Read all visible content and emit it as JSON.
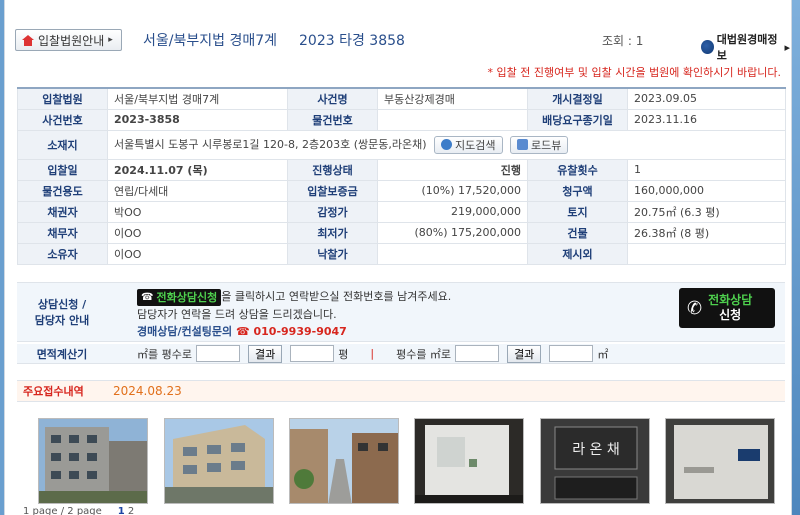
{
  "header": {
    "court_button": "입찰법원안내",
    "title": "서울/북부지법 경매7계",
    "case_no": "2023 타경 3858",
    "views_label": "조회 : 1",
    "supreme_link": "대법원경매정보"
  },
  "notice": "* 입찰 전 진행여부 및 입찰 시간을 법원에 확인하시기 바랍니다.",
  "info": {
    "court_label": "입찰법원",
    "court": "서울/북부지법 경매7계",
    "case_name_label": "사건명",
    "case_name": "부동산강제경매",
    "start_label": "개시결정일",
    "start": "2023.09.05",
    "case_no_label": "사건번호",
    "case_no": "2023-3858",
    "item_no_label": "물건번호",
    "item_no": "",
    "deadline_label": "배당요구종기일",
    "deadline": "2023.11.16",
    "address_label": "소재지",
    "address": "서울특별시 도봉구 시루봉로1길 120-8, 2층203호 (쌍문동,라온채)",
    "map_button": "지도검색",
    "road_button": "로드뷰",
    "bid_date_label": "입찰일",
    "bid_date": "2024.11.07 (목)",
    "status_label": "진행상태",
    "status": "진행",
    "fail_label": "유찰횟수",
    "fail": "1",
    "usage_label": "물건용도",
    "usage": "연립/다세대",
    "deposit_label": "입찰보증금",
    "deposit": "(10%) 17,520,000",
    "claim_label": "청구액",
    "claim": "160,000,000",
    "creditor_label": "채권자",
    "creditor": "박OO",
    "appraisal_label": "감정가",
    "appraisal": "219,000,000",
    "land_label": "토지",
    "land": "20.75㎡ (6.3 평)",
    "debtor_label": "채무자",
    "debtor": "이OO",
    "minimum_label": "최저가",
    "minimum": "(80%)  175,200,000",
    "building_label": "건물",
    "building": "26.38㎡ (8 평)",
    "owner_label": "소유자",
    "owner": "이OO",
    "winning_label": "낙찰가",
    "winning": "",
    "exclude_label": "제시외",
    "exclude": ""
  },
  "consult": {
    "label_1": "상담신청 /",
    "label_2": "담당자 안내",
    "tag": "전화상담신청",
    "line1": "을 클릭하시고 연락받으실 전화번호를 남겨주세요.",
    "line2": "담당자가 연락을 드려 상담을 드리겠습니다.",
    "contact_label": "경매상담/컨설팅문의",
    "phone": "010-9939-9047",
    "big_button_1": "전화상담",
    "big_button_2": "신청"
  },
  "calc": {
    "label": "면적계산기",
    "text1": "㎡를 평수로",
    "btn1": "결과",
    "unit1": "평",
    "text2": "평수를 ㎡로",
    "btn2": "결과",
    "unit2": "㎡"
  },
  "receipt": {
    "label": "주요접수내역",
    "date": "2024.08.23"
  },
  "pager": {
    "prev": "1 page",
    "sep": "/",
    "total": "2 page",
    "p1": "1",
    "p2": "2"
  }
}
